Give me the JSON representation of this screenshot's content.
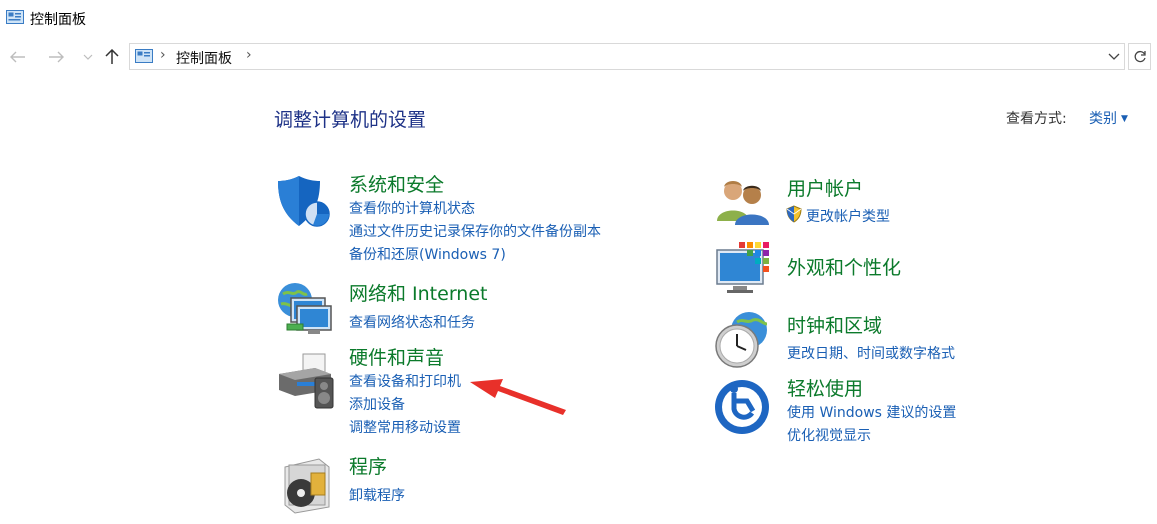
{
  "window": {
    "title": "控制面板"
  },
  "address_bar": {
    "crumb": "控制面板"
  },
  "main": {
    "heading": "调整计算机的设置",
    "view_by_label": "查看方式:",
    "view_by_value": "类别"
  },
  "categories": {
    "system": {
      "title": "系统和安全",
      "links": [
        "查看你的计算机状态",
        "通过文件历史记录保存你的文件备份副本",
        "备份和还原(Windows 7)"
      ]
    },
    "network": {
      "title": "网络和 Internet",
      "links": [
        "查看网络状态和任务"
      ]
    },
    "hardware": {
      "title": "硬件和声音",
      "links": [
        "查看设备和打印机",
        "添加设备",
        "调整常用移动设置"
      ]
    },
    "programs": {
      "title": "程序",
      "links": [
        "卸载程序"
      ]
    },
    "users": {
      "title": "用户帐户",
      "links": [
        "更改帐户类型"
      ]
    },
    "appearance": {
      "title": "外观和个性化",
      "links": []
    },
    "clock": {
      "title": "时钟和区域",
      "links": [
        "更改日期、时间或数字格式"
      ]
    },
    "ease": {
      "title": "轻松使用",
      "links": [
        "使用 Windows 建议的设置",
        "优化视觉显示"
      ]
    }
  },
  "annotation": {
    "arrow_color": "#e8302a"
  }
}
